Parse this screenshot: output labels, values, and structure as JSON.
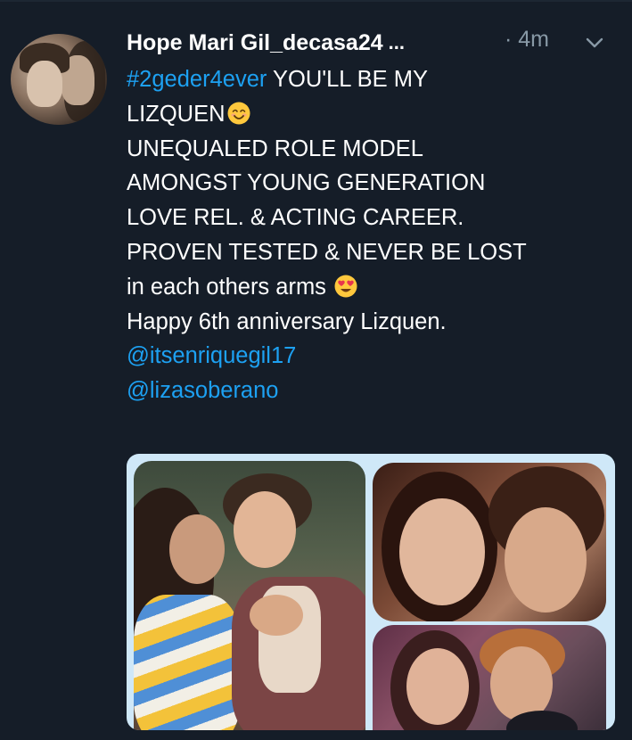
{
  "tweet": {
    "author_name": "Hope Mari Gil_decasa24",
    "truncation": "...",
    "time": "· 4m",
    "lines": [
      {
        "hashtag": "#2geder4ever",
        "text": " YOU'LL BE MY"
      },
      {
        "text": "LIZQUEN",
        "emoji": "smiling-face-icon"
      },
      {
        "text": "UNEQUALED ROLE MODEL"
      },
      {
        "text": "AMONGST YOUNG GENERATION"
      },
      {
        "text": "LOVE REL. &  ACTING CAREER."
      },
      {
        "text": "PROVEN TESTED & NEVER BE LOST"
      },
      {
        "text": "in each others arms ",
        "emoji": "heart-eyes-icon"
      },
      {
        "text": "Happy 6th anniversary Lizquen."
      }
    ],
    "mentions": [
      "@itsenriquegil17",
      "@lizasoberano"
    ]
  },
  "colors": {
    "background": "#151d28",
    "link": "#1da1f2",
    "muted": "#8899a6",
    "media_frame": "#cfe8f8"
  }
}
